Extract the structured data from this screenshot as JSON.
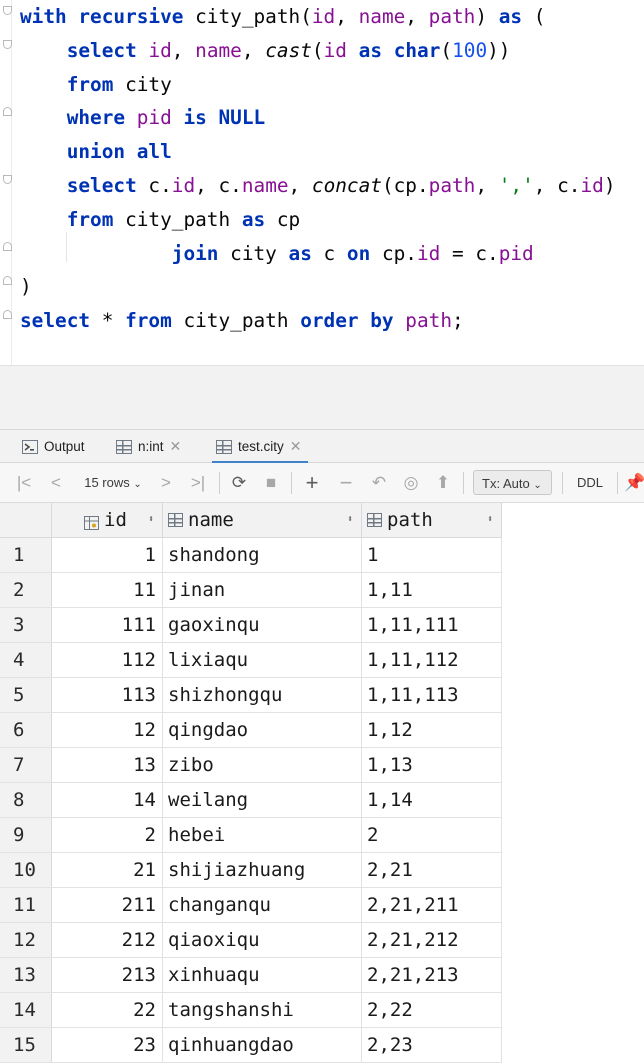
{
  "editor": {
    "lines": [
      {
        "tokens": [
          {
            "t": "with recursive",
            "c": "kw"
          },
          {
            "t": " city_path(",
            "c": ""
          },
          {
            "t": "id",
            "c": "id"
          },
          {
            "t": ", ",
            "c": ""
          },
          {
            "t": "name",
            "c": "id"
          },
          {
            "t": ", ",
            "c": ""
          },
          {
            "t": "path",
            "c": "id"
          },
          {
            "t": ") ",
            "c": ""
          },
          {
            "t": "as",
            "c": "kw"
          },
          {
            "t": " (",
            "c": ""
          }
        ]
      },
      {
        "tokens": [
          {
            "t": "    ",
            "c": ""
          },
          {
            "t": "select",
            "c": "kw"
          },
          {
            "t": " ",
            "c": ""
          },
          {
            "t": "id",
            "c": "id"
          },
          {
            "t": ", ",
            "c": ""
          },
          {
            "t": "name",
            "c": "id"
          },
          {
            "t": ", ",
            "c": ""
          },
          {
            "t": "cast",
            "c": "fn"
          },
          {
            "t": "(",
            "c": ""
          },
          {
            "t": "id",
            "c": "id"
          },
          {
            "t": " ",
            "c": ""
          },
          {
            "t": "as",
            "c": "kw"
          },
          {
            "t": " ",
            "c": ""
          },
          {
            "t": "char",
            "c": "kw"
          },
          {
            "t": "(",
            "c": ""
          },
          {
            "t": "100",
            "c": "num"
          },
          {
            "t": "))",
            "c": ""
          }
        ]
      },
      {
        "tokens": [
          {
            "t": "    ",
            "c": ""
          },
          {
            "t": "from",
            "c": "kw"
          },
          {
            "t": " city",
            "c": ""
          }
        ]
      },
      {
        "tokens": [
          {
            "t": "    ",
            "c": ""
          },
          {
            "t": "where",
            "c": "kw"
          },
          {
            "t": " ",
            "c": ""
          },
          {
            "t": "pid",
            "c": "id"
          },
          {
            "t": " ",
            "c": ""
          },
          {
            "t": "is NULL",
            "c": "kw"
          }
        ]
      },
      {
        "tokens": [
          {
            "t": "    ",
            "c": ""
          },
          {
            "t": "union all",
            "c": "kw"
          }
        ]
      },
      {
        "tokens": [
          {
            "t": "    ",
            "c": ""
          },
          {
            "t": "select",
            "c": "kw"
          },
          {
            "t": " c.",
            "c": ""
          },
          {
            "t": "id",
            "c": "id"
          },
          {
            "t": ", c.",
            "c": ""
          },
          {
            "t": "name",
            "c": "id"
          },
          {
            "t": ", ",
            "c": ""
          },
          {
            "t": "concat",
            "c": "fn"
          },
          {
            "t": "(cp.",
            "c": ""
          },
          {
            "t": "path",
            "c": "id"
          },
          {
            "t": ", ",
            "c": ""
          },
          {
            "t": "','",
            "c": "str"
          },
          {
            "t": ", c.",
            "c": ""
          },
          {
            "t": "id",
            "c": "id"
          },
          {
            "t": ")",
            "c": ""
          }
        ]
      },
      {
        "tokens": [
          {
            "t": "    ",
            "c": ""
          },
          {
            "t": "from",
            "c": "kw"
          },
          {
            "t": " city_path ",
            "c": ""
          },
          {
            "t": "as",
            "c": "kw"
          },
          {
            "t": " cp",
            "c": ""
          }
        ]
      },
      {
        "tokens": [
          {
            "t": "             ",
            "c": ""
          },
          {
            "t": "join",
            "c": "kw"
          },
          {
            "t": " city ",
            "c": ""
          },
          {
            "t": "as",
            "c": "kw"
          },
          {
            "t": " c ",
            "c": ""
          },
          {
            "t": "on",
            "c": "kw"
          },
          {
            "t": " cp.",
            "c": ""
          },
          {
            "t": "id",
            "c": "id"
          },
          {
            "t": " = c.",
            "c": ""
          },
          {
            "t": "pid",
            "c": "id"
          }
        ]
      },
      {
        "tokens": [
          {
            "t": ")",
            "c": ""
          }
        ]
      },
      {
        "tokens": [
          {
            "t": "select",
            "c": "kw"
          },
          {
            "t": " * ",
            "c": ""
          },
          {
            "t": "from",
            "c": "kw"
          },
          {
            "t": " city_path ",
            "c": ""
          },
          {
            "t": "order by",
            "c": "kw"
          },
          {
            "t": " ",
            "c": ""
          },
          {
            "t": "path",
            "c": "id"
          },
          {
            "t": ";",
            "c": ""
          }
        ]
      }
    ]
  },
  "tabs": [
    {
      "label": "Output",
      "icon": "console-output-icon"
    },
    {
      "label": "n:int",
      "icon": "table-grid-icon"
    },
    {
      "label": "test.city",
      "icon": "table-grid-icon"
    }
  ],
  "toolbar": {
    "rows_label": "15 rows",
    "tx_label": "Tx: Auto",
    "ddl_label": "DDL"
  },
  "table": {
    "columns": [
      "id",
      "name",
      "path"
    ],
    "rows": [
      {
        "n": "1",
        "id": "1",
        "name": "shandong",
        "path": "1"
      },
      {
        "n": "2",
        "id": "11",
        "name": "jinan",
        "path": "1,11"
      },
      {
        "n": "3",
        "id": "111",
        "name": "gaoxinqu",
        "path": "1,11,111"
      },
      {
        "n": "4",
        "id": "112",
        "name": "lixiaqu",
        "path": "1,11,112"
      },
      {
        "n": "5",
        "id": "113",
        "name": "shizhongqu",
        "path": "1,11,113"
      },
      {
        "n": "6",
        "id": "12",
        "name": "qingdao",
        "path": "1,12"
      },
      {
        "n": "7",
        "id": "13",
        "name": "zibo",
        "path": "1,13"
      },
      {
        "n": "8",
        "id": "14",
        "name": "weilang",
        "path": "1,14"
      },
      {
        "n": "9",
        "id": "2",
        "name": "hebei",
        "path": "2"
      },
      {
        "n": "10",
        "id": "21",
        "name": "shijiazhuang",
        "path": "2,21"
      },
      {
        "n": "11",
        "id": "211",
        "name": "changanqu",
        "path": "2,21,211"
      },
      {
        "n": "12",
        "id": "212",
        "name": "qiaoxiqu",
        "path": "2,21,212"
      },
      {
        "n": "13",
        "id": "213",
        "name": "xinhuaqu",
        "path": "2,21,213"
      },
      {
        "n": "14",
        "id": "22",
        "name": "tangshanshi",
        "path": "2,22"
      },
      {
        "n": "15",
        "id": "23",
        "name": "qinhuangdao",
        "path": "2,23"
      }
    ]
  }
}
